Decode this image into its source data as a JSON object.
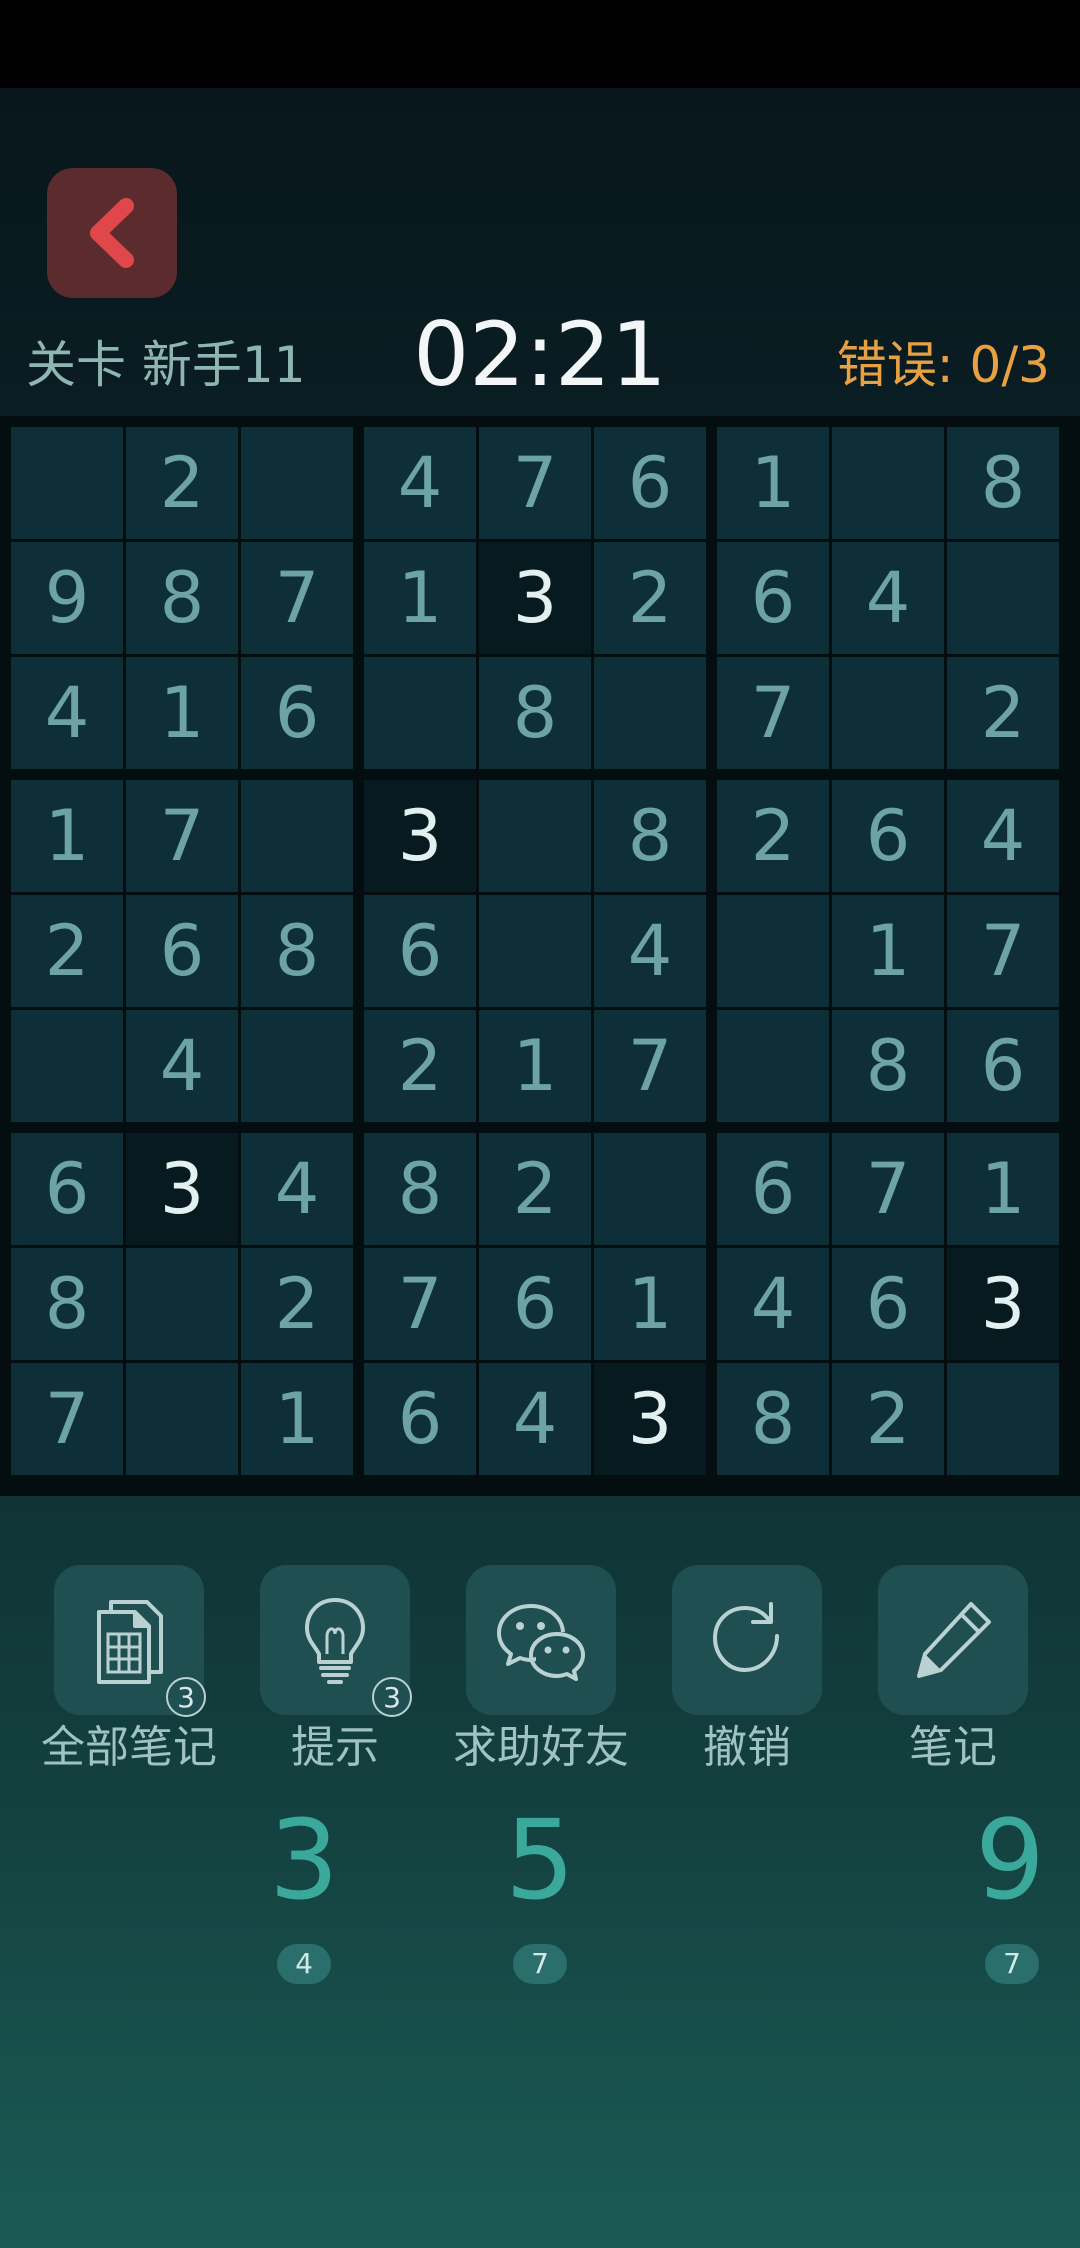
{
  "header": {
    "level_label": "关卡 新手11",
    "timer": "02:21",
    "errors": "错误: 0/3"
  },
  "board": {
    "rows": [
      [
        "",
        "2",
        "",
        "4",
        "7",
        "6",
        "1",
        "",
        "8"
      ],
      [
        "9",
        "8",
        "7",
        "1",
        "3",
        "2",
        "6",
        "4",
        ""
      ],
      [
        "4",
        "1",
        "6",
        "",
        "8",
        "",
        "7",
        "",
        "2"
      ],
      [
        "1",
        "7",
        "",
        "3",
        "",
        "8",
        "2",
        "6",
        "4"
      ],
      [
        "2",
        "6",
        "8",
        "6",
        "",
        "4",
        "",
        "1",
        "7"
      ],
      [
        "",
        "4",
        "",
        "2",
        "1",
        "7",
        "",
        "8",
        "6"
      ],
      [
        "6",
        "3",
        "4",
        "8",
        "2",
        "",
        "6",
        "7",
        "1"
      ],
      [
        "8",
        "",
        "2",
        "7",
        "6",
        "1",
        "4",
        "6",
        "3"
      ],
      [
        "7",
        "",
        "1",
        "6",
        "4",
        "3",
        "8",
        "2",
        ""
      ]
    ],
    "highlighted_value": "3"
  },
  "toolbar": {
    "all_notes": {
      "label": "全部笔记",
      "badge": "3",
      "icon": "notes-grid-icon"
    },
    "hint": {
      "label": "提示",
      "badge": "3",
      "icon": "lightbulb-icon"
    },
    "ask_friend": {
      "label": "求助好友",
      "icon": "wechat-icon"
    },
    "undo": {
      "label": "撤销",
      "icon": "undo-icon"
    },
    "notes": {
      "label": "笔记",
      "icon": "pencil-icon"
    }
  },
  "number_pad": [
    {
      "digit": "3",
      "remaining": "4"
    },
    {
      "digit": "5",
      "remaining": "7"
    },
    {
      "digit": "9",
      "remaining": "7"
    }
  ],
  "colors": {
    "background_top": "#071519",
    "background_bottom": "#1b5b55",
    "cell": "#0e2f37",
    "cell_highlight": "#061a1f",
    "digit": "#6ea3a3",
    "digit_highlight": "#e3f0f0",
    "accent": "#3aa99b",
    "error_text": "#e7a142",
    "back_button": "#5b2b2e",
    "back_chevron": "#e0474a"
  }
}
